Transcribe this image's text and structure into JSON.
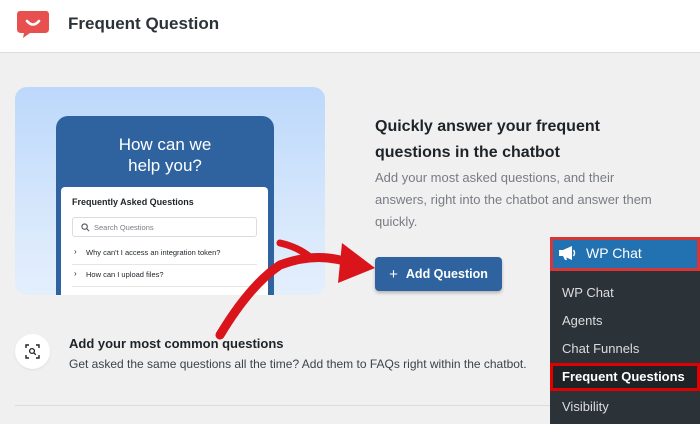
{
  "header": {
    "title": "Frequent Question"
  },
  "hero": {
    "heading_line1": "How can we",
    "heading_line2": "help you?",
    "faq_title": "Frequently Asked Questions",
    "search_placeholder": "Search Questions",
    "questions": [
      "Why can't I access an integration token?",
      "How can I upload files?"
    ]
  },
  "main": {
    "headline_line1": "Quickly answer your frequent",
    "headline_line2": "questions in the chatbot",
    "description": "Add your most asked questions, and their answers, right into the chatbot and answer them quickly.",
    "add_button": "Add Question"
  },
  "feature": {
    "title": "Add your most common questions",
    "description": "Get asked the same questions all the time? Add them to FAQs right within the chatbot."
  },
  "admin_menu": {
    "title": "WP Chat",
    "items": [
      "WP Chat",
      "Agents",
      "Chat Funnels",
      "Frequent Questions",
      "Visibility"
    ],
    "active_item": "Frequent Questions"
  },
  "colors": {
    "accent": "#2f63a0",
    "highlight": "#e00000",
    "logo": "#e8504f"
  },
  "icons": {
    "logo": "chat-smile-logo",
    "feature": "scan-icon",
    "menu": "megaphone-icon",
    "button": "plus-icon"
  }
}
